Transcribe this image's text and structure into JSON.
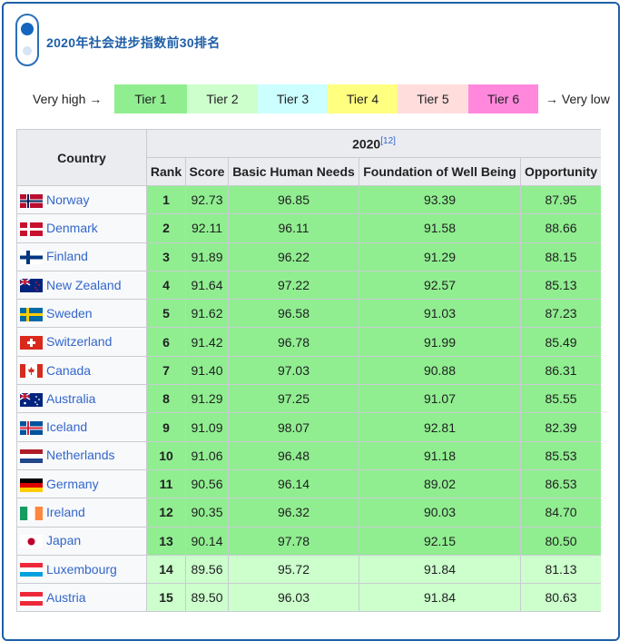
{
  "title": "2020年社会进步指数前30排名",
  "legend": {
    "left_label": "Very high →",
    "right_label": "→ Very low",
    "tiers": [
      {
        "label": "Tier 1",
        "color": "#90ee90"
      },
      {
        "label": "Tier 2",
        "color": "#ccffcc"
      },
      {
        "label": "Tier 3",
        "color": "#ccffff"
      },
      {
        "label": "Tier 4",
        "color": "#ffff80"
      },
      {
        "label": "Tier 5",
        "color": "#ffdddd"
      },
      {
        "label": "Tier 6",
        "color": "#ff88dd"
      }
    ]
  },
  "table": {
    "header_country": "Country",
    "header_year": "2020",
    "header_ref": "[12]",
    "columns": [
      "Rank",
      "Score",
      "Basic Human Needs",
      "Foundation of Well Being",
      "Opportunity"
    ],
    "rows": [
      {
        "country": "Norway",
        "flag": "norway-flag-icon",
        "rank": "1",
        "score": "92.73",
        "bhn": "96.85",
        "fwb": "93.39",
        "opp": "87.95",
        "tier": "tier1"
      },
      {
        "country": "Denmark",
        "flag": "denmark-flag-icon",
        "rank": "2",
        "score": "92.11",
        "bhn": "96.11",
        "fwb": "91.58",
        "opp": "88.66",
        "tier": "tier1"
      },
      {
        "country": "Finland",
        "flag": "finland-flag-icon",
        "rank": "3",
        "score": "91.89",
        "bhn": "96.22",
        "fwb": "91.29",
        "opp": "88.15",
        "tier": "tier1"
      },
      {
        "country": "New Zealand",
        "flag": "new-zealand-flag-icon",
        "rank": "4",
        "score": "91.64",
        "bhn": "97.22",
        "fwb": "92.57",
        "opp": "85.13",
        "tier": "tier1"
      },
      {
        "country": "Sweden",
        "flag": "sweden-flag-icon",
        "rank": "5",
        "score": "91.62",
        "bhn": "96.58",
        "fwb": "91.03",
        "opp": "87.23",
        "tier": "tier1"
      },
      {
        "country": "Switzerland",
        "flag": "switzerland-flag-icon",
        "rank": "6",
        "score": "91.42",
        "bhn": "96.78",
        "fwb": "91.99",
        "opp": "85.49",
        "tier": "tier1"
      },
      {
        "country": "Canada",
        "flag": "canada-flag-icon",
        "rank": "7",
        "score": "91.40",
        "bhn": "97.03",
        "fwb": "90.88",
        "opp": "86.31",
        "tier": "tier1"
      },
      {
        "country": "Australia",
        "flag": "australia-flag-icon",
        "rank": "8",
        "score": "91.29",
        "bhn": "97.25",
        "fwb": "91.07",
        "opp": "85.55",
        "tier": "tier1"
      },
      {
        "country": "Iceland",
        "flag": "iceland-flag-icon",
        "rank": "9",
        "score": "91.09",
        "bhn": "98.07",
        "fwb": "92.81",
        "opp": "82.39",
        "tier": "tier1"
      },
      {
        "country": "Netherlands",
        "flag": "netherlands-flag-icon",
        "rank": "10",
        "score": "91.06",
        "bhn": "96.48",
        "fwb": "91.18",
        "opp": "85.53",
        "tier": "tier1"
      },
      {
        "country": "Germany",
        "flag": "germany-flag-icon",
        "rank": "11",
        "score": "90.56",
        "bhn": "96.14",
        "fwb": "89.02",
        "opp": "86.53",
        "tier": "tier1"
      },
      {
        "country": "Ireland",
        "flag": "ireland-flag-icon",
        "rank": "12",
        "score": "90.35",
        "bhn": "96.32",
        "fwb": "90.03",
        "opp": "84.70",
        "tier": "tier1"
      },
      {
        "country": "Japan",
        "flag": "japan-flag-icon",
        "rank": "13",
        "score": "90.14",
        "bhn": "97.78",
        "fwb": "92.15",
        "opp": "80.50",
        "tier": "tier1"
      },
      {
        "country": "Luxembourg",
        "flag": "luxembourg-flag-icon",
        "rank": "14",
        "score": "89.56",
        "bhn": "95.72",
        "fwb": "91.84",
        "opp": "81.13",
        "tier": "tier2"
      },
      {
        "country": "Austria",
        "flag": "austria-flag-icon",
        "rank": "15",
        "score": "89.50",
        "bhn": "96.03",
        "fwb": "91.84",
        "opp": "80.63",
        "tier": "tier2"
      }
    ]
  },
  "colors": {
    "tier1": "#90ee90",
    "tier2": "#ccffcc",
    "accent": "#1f5fa8",
    "link": "#3366cc"
  }
}
